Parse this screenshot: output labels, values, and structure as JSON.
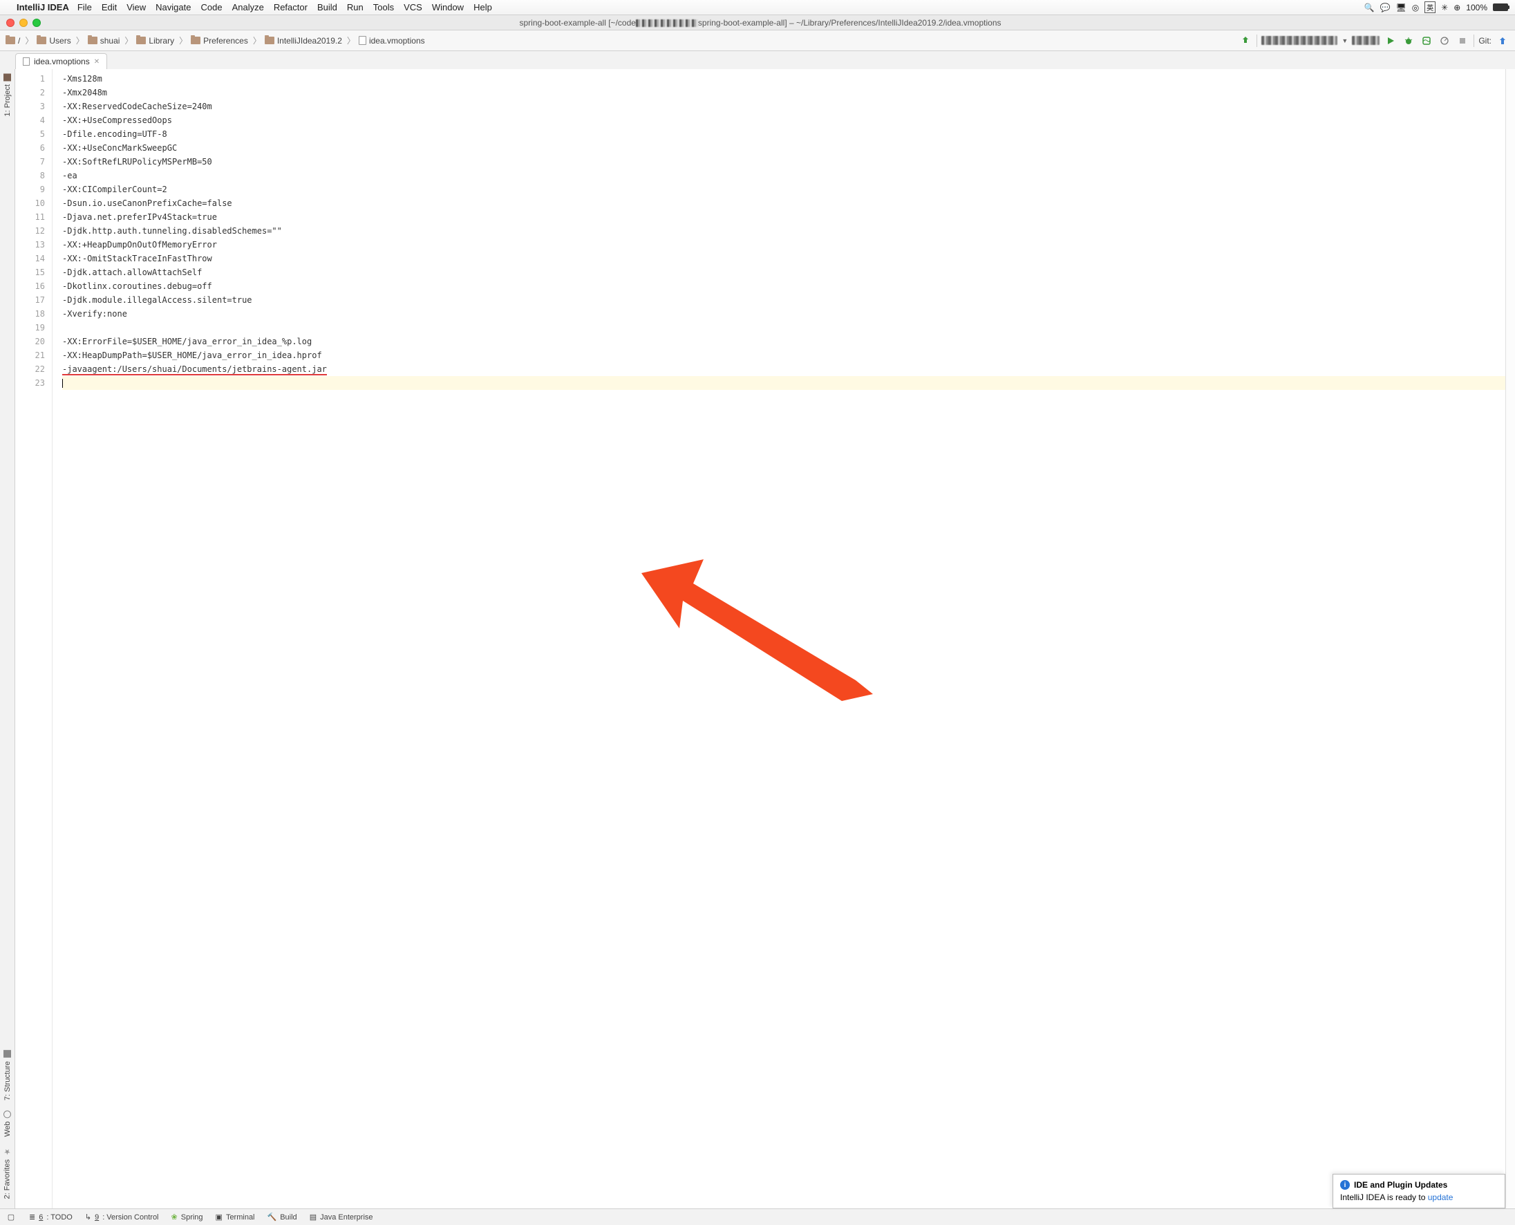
{
  "mac_menu": {
    "app": "IntelliJ IDEA",
    "items": [
      "File",
      "Edit",
      "View",
      "Navigate",
      "Code",
      "Analyze",
      "Refactor",
      "Build",
      "Run",
      "Tools",
      "VCS",
      "Window",
      "Help"
    ],
    "right": {
      "battery": "100%",
      "input": "英"
    }
  },
  "window_title": {
    "prefix": "spring-boot-example-all [~/code",
    "middle": "spring-boot-example-all] – ~/Library/Preferences/IntelliJIdea2019.2/idea.vmoptions"
  },
  "breadcrumbs": [
    "/",
    "Users",
    "shuai",
    "Library",
    "Preferences",
    "IntelliJIdea2019.2",
    "idea.vmoptions"
  ],
  "toolbar_right": {
    "git_label": "Git:"
  },
  "tab": {
    "name": "idea.vmoptions"
  },
  "left_sidebar": [
    "1: Project",
    "7: Structure",
    "Web",
    "2: Favorites"
  ],
  "editor": {
    "lines": [
      "-Xms128m",
      "-Xmx2048m",
      "-XX:ReservedCodeCacheSize=240m",
      "-XX:+UseCompressedOops",
      "-Dfile.encoding=UTF-8",
      "-XX:+UseConcMarkSweepGC",
      "-XX:SoftRefLRUPolicyMSPerMB=50",
      "-ea",
      "-XX:CICompilerCount=2",
      "-Dsun.io.useCanonPrefixCache=false",
      "-Djava.net.preferIPv4Stack=true",
      "-Djdk.http.auth.tunneling.disabledSchemes=\"\"",
      "-XX:+HeapDumpOnOutOfMemoryError",
      "-XX:-OmitStackTraceInFastThrow",
      "-Djdk.attach.allowAttachSelf",
      "-Dkotlinx.coroutines.debug=off",
      "-Djdk.module.illegalAccess.silent=true",
      "-Xverify:none",
      "",
      "-XX:ErrorFile=$USER_HOME/java_error_in_idea_%p.log",
      "-XX:HeapDumpPath=$USER_HOME/java_error_in_idea.hprof",
      "-javaagent:/Users/shuai/Documents/jetbrains-agent.jar",
      ""
    ],
    "caret_line_index": 22,
    "underline_line_index": 21
  },
  "bottombar": {
    "items": [
      {
        "u": "6",
        "label": ": TODO"
      },
      {
        "u": "9",
        "label": ": Version Control"
      },
      {
        "u": "",
        "label": "Spring"
      },
      {
        "u": "",
        "label": "Terminal"
      },
      {
        "u": "",
        "label": "Build"
      },
      {
        "u": "",
        "label": "Java Enterprise"
      }
    ]
  },
  "popup": {
    "title": "IDE and Plugin Updates",
    "body_prefix": "IntelliJ IDEA is ready to ",
    "body_link": "update"
  }
}
